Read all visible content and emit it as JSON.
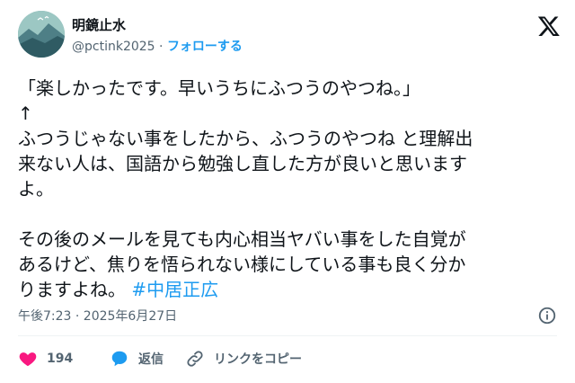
{
  "author": {
    "display_name": "明鏡止水",
    "handle": "@pctink2025",
    "separator": " · ",
    "follow_label": "フォローする"
  },
  "tweet": {
    "text_main": "「楽しかったです。早いうちにふつうのやつね。」\n↑\nふつうじゃない事をしたから、ふつうのやつね と理解出\n来ない人は、国語から勉強し直した方が良いと思います\nよ。\n\nその後のメールを見ても内心相当ヤバい事をした自覚が\nあるけど、焦りを悟られない様にしている事も良く分か\nりますよね。",
    "hashtag": "#中居正広",
    "timestamp": "午後7:23 · 2025年6月27日"
  },
  "actions": {
    "like_count": "194",
    "reply_label": "返信",
    "copy_link_label": "リンクをコピー"
  },
  "colors": {
    "accent": "#1d9bf0",
    "like": "#f91880",
    "text": "#0f1419",
    "secondary": "#536471"
  },
  "icons": [
    "x-logo-icon",
    "info-icon",
    "heart-icon",
    "reply-bubble-icon",
    "link-icon"
  ]
}
